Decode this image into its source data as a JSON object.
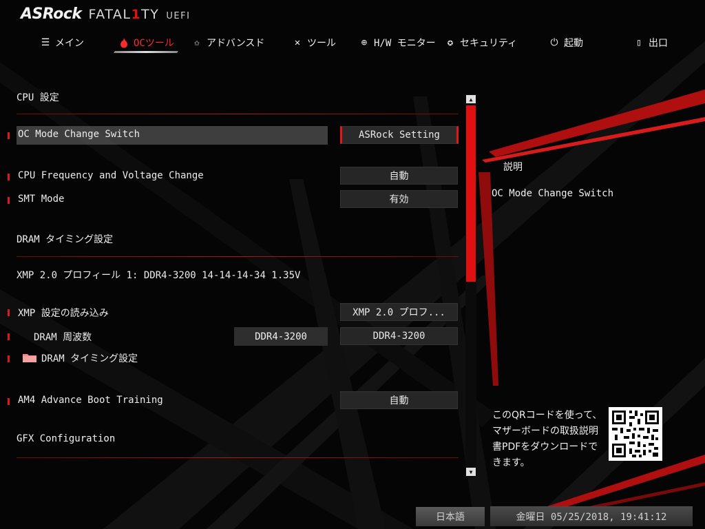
{
  "header": {
    "brand": "ASRock",
    "series": "FATAL1TY",
    "uefi": "UEFI"
  },
  "tabs": [
    {
      "label": "メイン",
      "icon": "list-icon",
      "active": false
    },
    {
      "label": "OCツール",
      "icon": "flame-icon",
      "active": true
    },
    {
      "label": "アドバンスド",
      "icon": "star-icon",
      "active": false
    },
    {
      "label": "ツール",
      "icon": "tools-icon",
      "active": false
    },
    {
      "label": "H/W モニター",
      "icon": "crosshair-icon",
      "active": false
    },
    {
      "label": "セキュリティ",
      "icon": "shield-icon",
      "active": false
    },
    {
      "label": "起動",
      "icon": "power-icon",
      "active": false
    },
    {
      "label": "出口",
      "icon": "exit-icon",
      "active": false
    }
  ],
  "content": {
    "cpu_section": "CPU 設定",
    "oc_mode": {
      "label": "OC Mode Change Switch",
      "value": "ASRock Setting"
    },
    "cpu_freq": {
      "label": "CPU Frequency and Voltage Change",
      "value": "自動"
    },
    "smt": {
      "label": "SMT Mode",
      "value": "有効"
    },
    "dram_section": "DRAM タイミング設定",
    "xmp_profile": "XMP 2.0 プロフィール 1: DDR4-3200 14-14-14-34 1.35V",
    "xmp_load": {
      "label": "XMP 設定の読み込み",
      "value": "XMP 2.0 プロフ..."
    },
    "dram_freq": {
      "label": "DRAM 周波数",
      "current": "DDR4-3200",
      "value": "DDR4-3200"
    },
    "dram_timing": {
      "label": "DRAM タイミング設定",
      "icon": "folder-icon"
    },
    "am4": {
      "label": "AM4 Advance Boot Training",
      "value": "自動"
    },
    "gfx_section": "GFX Configuration"
  },
  "description": {
    "title": "説明",
    "text": "OC Mode Change Switch",
    "qr_text": "このQRコードを使って、マザーボードの取扱説明書PDFをダウンロードできます。"
  },
  "footer": {
    "language": "日本語",
    "datetime": "金曜日 05/25/2018, 19:41:12"
  },
  "colors": {
    "accent": "#e01818",
    "background": "#050505",
    "text": "#e8e8e8"
  }
}
